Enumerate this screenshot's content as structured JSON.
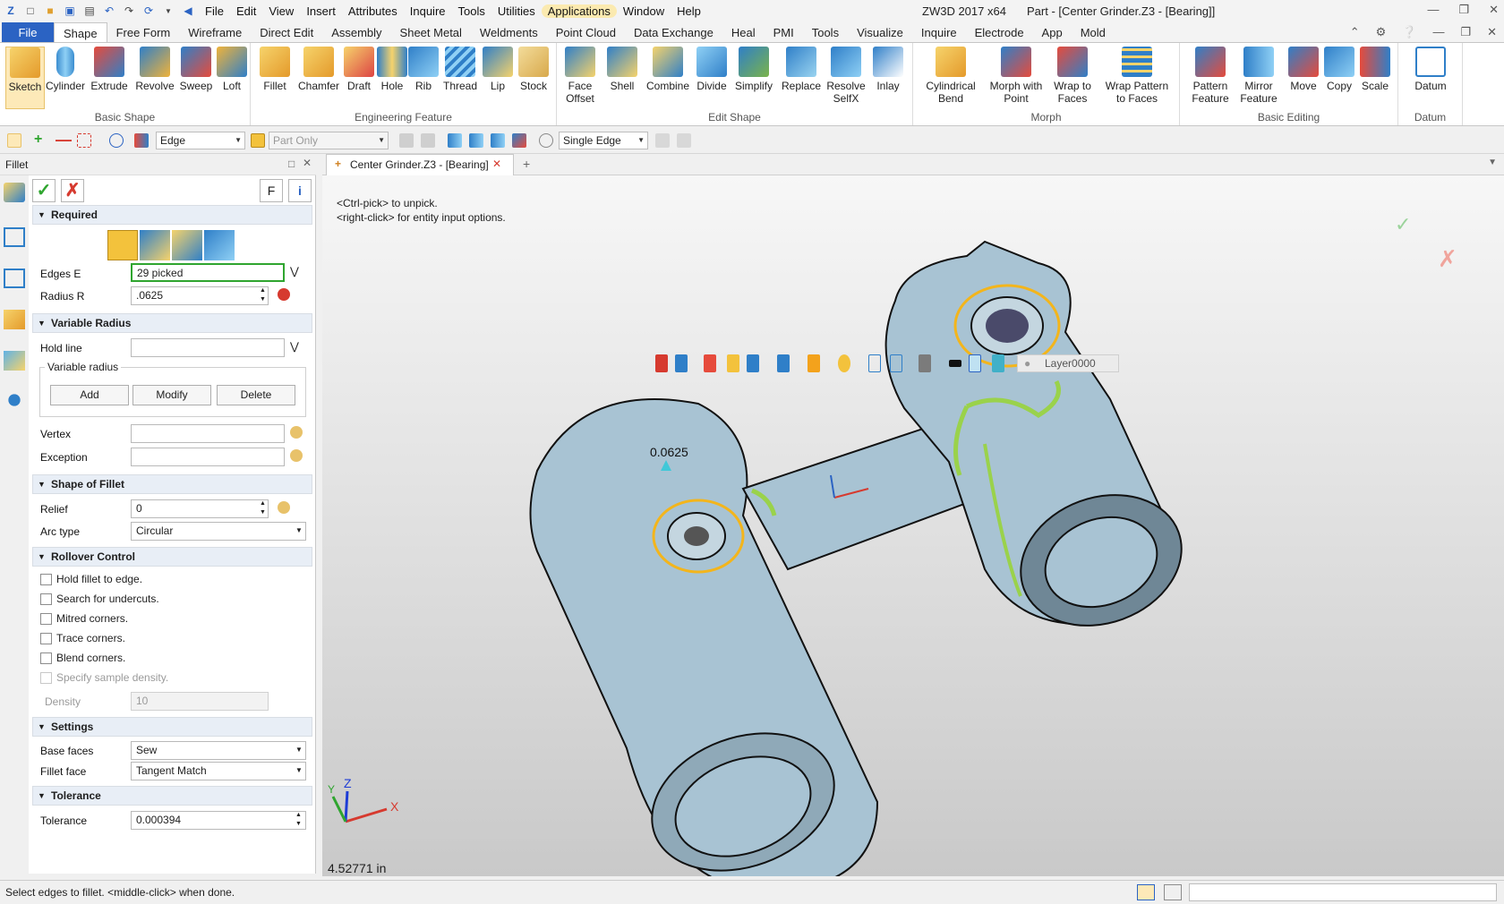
{
  "app": {
    "title_app": "ZW3D 2017  x64",
    "title_doc": "Part - [Center Grinder.Z3 - [Bearing]]",
    "menu": [
      "File",
      "Edit",
      "View",
      "Insert",
      "Attributes",
      "Inquire",
      "Tools",
      "Utilities",
      "Applications",
      "Window",
      "Help"
    ]
  },
  "ribbon_tabs": {
    "file": "File",
    "tabs": [
      "Shape",
      "Free Form",
      "Wireframe",
      "Direct Edit",
      "Assembly",
      "Sheet Metal",
      "Weldments",
      "Point Cloud",
      "Data Exchange",
      "Heal",
      "PMI",
      "Tools",
      "Visualize",
      "Inquire",
      "Electrode",
      "App",
      "Mold"
    ]
  },
  "ribbon": {
    "basic_shape": {
      "label": "Basic Shape",
      "buttons": [
        "Sketch",
        "Cylinder",
        "Extrude",
        "Revolve",
        "Sweep",
        "Loft"
      ]
    },
    "engineering": {
      "label": "Engineering Feature",
      "buttons": [
        "Fillet",
        "Chamfer",
        "Draft",
        "Hole",
        "Rib",
        "Thread",
        "Lip",
        "Stock"
      ]
    },
    "edit_shape": {
      "label": "Edit Shape",
      "buttons": [
        "Face\nOffset",
        "Shell",
        "Combine",
        "Divide",
        "Simplify",
        "Replace",
        "Resolve\nSelfX",
        "Inlay"
      ]
    },
    "morph": {
      "label": "Morph",
      "buttons": [
        "Cylindrical\nBend",
        "Morph with\nPoint",
        "Wrap to\nFaces",
        "Wrap Pattern\nto Faces"
      ]
    },
    "basic_editing": {
      "label": "Basic Editing",
      "buttons": [
        "Pattern\nFeature",
        "Mirror\nFeature",
        "Move",
        "Copy",
        "Scale"
      ]
    },
    "datum": {
      "label": "Datum",
      "buttons": [
        "Datum"
      ]
    }
  },
  "toolbar": {
    "filter": "Edge",
    "scope": "Part Only",
    "pick_mode": "Single Edge"
  },
  "panel": {
    "title": "Fillet",
    "f_button": "F",
    "required": {
      "header": "Required",
      "edges_label": "Edges E",
      "edges_value": "29 picked",
      "radius_label": "Radius R",
      "radius_value": ".0625"
    },
    "variable_radius": {
      "header": "Variable Radius",
      "hold_line_label": "Hold line",
      "group_label": "Variable radius",
      "add": "Add",
      "modify": "Modify",
      "delete": "Delete",
      "vertex_label": "Vertex",
      "exception_label": "Exception"
    },
    "shape_of_fillet": {
      "header": "Shape of Fillet",
      "relief_label": "Relief",
      "relief_value": "0",
      "arc_type_label": "Arc type",
      "arc_type_value": "Circular"
    },
    "rollover": {
      "header": "Rollover Control",
      "options": [
        "Hold fillet to edge.",
        "Search for undercuts.",
        "Mitred corners.",
        "Trace corners.",
        "Blend corners.",
        "Specify sample density."
      ],
      "density_label": "Density",
      "density_value": "10"
    },
    "settings": {
      "header": "Settings",
      "base_faces_label": "Base faces",
      "base_faces_value": "Sew",
      "fillet_face_label": "Fillet face",
      "fillet_face_value": "Tangent Match"
    },
    "tolerance": {
      "header": "Tolerance",
      "tolerance_label": "Tolerance",
      "tolerance_value": "0.000394"
    }
  },
  "viewport": {
    "doc_tab": "Center Grinder.Z3 - [Bearing]",
    "layer": "Layer0000",
    "hint1": "<Ctrl-pick> to unpick.",
    "hint2": "<right-click> for entity input options.",
    "dim_label": "0.0625",
    "measure": "4.52771 in",
    "axis_x": "X",
    "axis_y": "Y",
    "axis_z": "Z"
  },
  "status": {
    "message": "Select edges to fillet.  <middle-click> when done."
  },
  "colors": {
    "accent": "#2b63c3",
    "ok": "#2fa52f",
    "cancel": "#d63a2f",
    "part": "#a8c3d3",
    "highlight": "#f3b51c"
  }
}
